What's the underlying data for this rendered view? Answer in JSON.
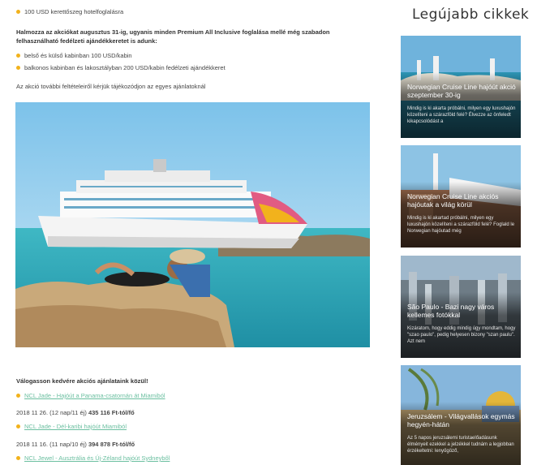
{
  "article": {
    "top_bullet": "100 USD kerettőszeg hotelfoglalásra",
    "intro": "Halmozza az akciókat augusztus 31-ig, ugyanis minden Premium All Inclusive foglalása mellé még szabadon felhasználható fedélzeti ajándékkeretet is adunk:",
    "bullets": [
      "belső és külső kabinban 100 USD/kabin",
      "balkonos kabinban és lakosztályban 200 USD/kabin fedélzeti ajándékkeret"
    ],
    "note": "Az akció további feltételeiről kérjük tájékozódjon az egyes ajánlatoknál",
    "hero_alt": "Norwegian cruise ship and woman relaxing on a beach rock",
    "choose_heading": "Válogasson kedvére akciós ajánlataink közül!",
    "offers": [
      {
        "link": "NCL Jade - Hajóút a Panama-csatornán át Miamiból",
        "meta": "2018 11 26. (12 nap/11 éj)",
        "price": "435 116 Ft-tól/fő"
      },
      {
        "link": "NCL Jade - Dél-karibi hajóút Miamiból",
        "meta": "2018 11 16. (11 nap/10 éj)",
        "price": "394 878 Ft-tól/fő"
      },
      {
        "link": "NCL Jewel - Ausztrália és Új-Zéland hajóút Sydneyből",
        "meta": "",
        "price": ""
      }
    ]
  },
  "sidebar": {
    "title": "Legújabb cikkek",
    "cards": [
      {
        "title": "Norwegian Cruise Line hajóút akció szeptember 30-ig",
        "excerpt": "Mindig is ki akarta próbálni, milyen egy luxushajón közelíteni a szárazföld felé? Élvezze az önfeledt kikapcsolódást a"
      },
      {
        "title": "Norwegian Cruise Line akciós hajóutak a világ körül",
        "excerpt": "Mindig is ki akartad próbálni, milyen egy luxushajón közelíteni a szárazföld felé? Foglald le Norwegian hajóutad még"
      },
      {
        "title": "São Paulo - Bazi nagy város kellemes fotókkal",
        "excerpt": "Kizáratom, hogy eddig mindig úgy mondtam, hogy \"szao paulo\", pedig helyesen bizony \"szan paulu\". Azt nem"
      },
      {
        "title": "Jeruzsálem - Világvallások egymás hegyén-hátán",
        "excerpt": "Az 5 napos jeruzsálemi turistaelőadásunk élményeit ezekkel a jelzékkel tudnám a legjobban érzékeltetni: lenyűgöző,"
      }
    ]
  }
}
